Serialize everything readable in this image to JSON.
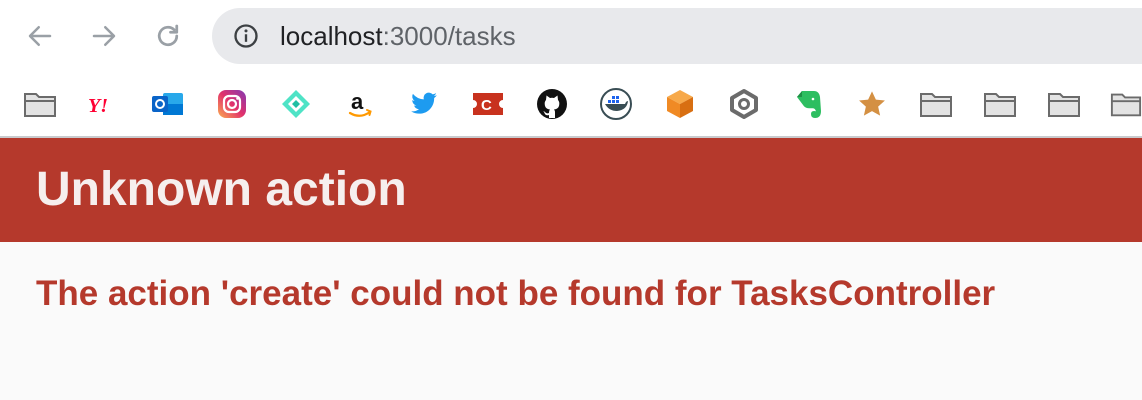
{
  "browser": {
    "url_host": "localhost",
    "url_path": ":3000/tasks",
    "bookmarks": [
      {
        "icon": "folder-icon",
        "color": "#6b6b6b"
      },
      {
        "icon": "yahoo-icon",
        "color": "#ff0033"
      },
      {
        "icon": "outlook-icon",
        "color": "#0a64c8"
      },
      {
        "icon": "instagram-icon",
        "color": "#d62976"
      },
      {
        "icon": "diamond-logo-icon",
        "color": "#2bd1b2"
      },
      {
        "icon": "amazon-icon",
        "color": "#111111"
      },
      {
        "icon": "twitter-icon",
        "color": "#1d9bf0"
      },
      {
        "icon": "ticket-icon",
        "color": "#c8321e"
      },
      {
        "icon": "github-icon",
        "color": "#111111"
      },
      {
        "icon": "docker-icon",
        "color": "#1d63ed"
      },
      {
        "icon": "cube-icon",
        "color": "#f08a24"
      },
      {
        "icon": "hexagon-icon",
        "color": "#6b6b6b"
      },
      {
        "icon": "evernote-icon",
        "color": "#2dbe60"
      },
      {
        "icon": "star-icon",
        "color": "#c98a3e"
      },
      {
        "icon": "folder-icon",
        "color": "#6b6b6b"
      },
      {
        "icon": "folder-icon",
        "color": "#6b6b6b"
      },
      {
        "icon": "folder-icon",
        "color": "#6b6b6b"
      },
      {
        "icon": "folder-icon",
        "color": "#6b6b6b"
      }
    ]
  },
  "page": {
    "title": "Unknown action",
    "message": "The action 'create' could not be found for TasksController",
    "accent_color": "#b5392c"
  }
}
